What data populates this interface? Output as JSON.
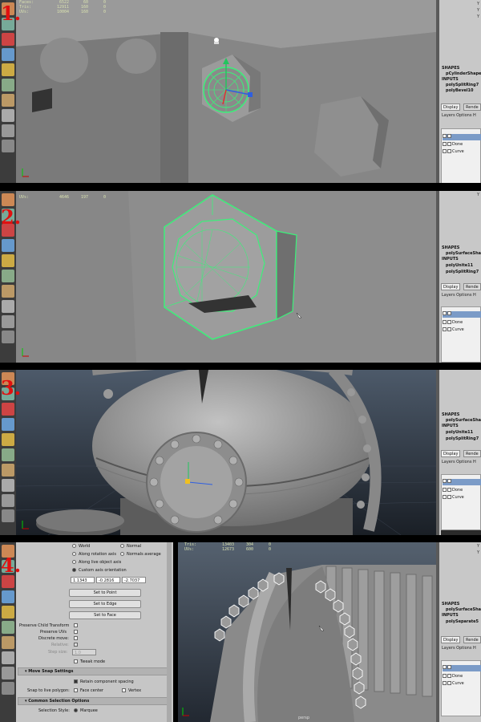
{
  "steps": [
    "1.",
    "2.",
    "3.",
    "4."
  ],
  "panel1": {
    "hud": [
      {
        "label": "Faces:",
        "v1": "6522",
        "v2": "60",
        "v3": "0"
      },
      {
        "label": "Tris:",
        "v1": "12911",
        "v2": "160",
        "v3": "0"
      },
      {
        "label": "UVs:",
        "v1": "10004",
        "v2": "160",
        "v3": "0"
      }
    ],
    "right": {
      "shapes_label": "SHAPES",
      "shape": "pCylinderShape",
      "inputs_label": "INPUTS",
      "inputs": [
        "polySplitRing7",
        "polyBevel10"
      ],
      "tabs": [
        "Display",
        "Rende"
      ],
      "menu": "Layers   Options   H",
      "layers": [
        "Done",
        "Curve"
      ]
    }
  },
  "panel2": {
    "hud": [
      {
        "label": "UVs:",
        "v1": "4646",
        "v2": "197",
        "v3": "0"
      }
    ],
    "right": {
      "shapes_label": "SHAPES",
      "shape": "polySurfaceShap",
      "inputs_label": "INPUTS",
      "inputs": [
        "polyUnite11",
        "polySplitRing7"
      ],
      "tabs": [
        "Display",
        "Rende"
      ],
      "menu": "Layers   Options   H",
      "layers": [
        "Done",
        "Curve"
      ]
    }
  },
  "panel3": {
    "right": {
      "shapes_label": "SHAPES",
      "shape": "polySurfaceShap",
      "inputs_label": "INPUTS",
      "inputs": [
        "polyUnite11",
        "polySplitRing7"
      ],
      "tabs": [
        "Display",
        "Rende"
      ],
      "menu": "Layers   Options   H",
      "layers": [
        "Done",
        "Curve"
      ]
    }
  },
  "panel4": {
    "hud": [
      {
        "label": "Tris:",
        "v1": "13403",
        "v2": "304",
        "v3": "0"
      },
      {
        "label": "UVs:",
        "v1": "12673",
        "v2": "600",
        "v3": "0"
      }
    ],
    "tool_settings": {
      "axis_options": [
        "World",
        "Normal",
        "Along rotation axis",
        "Normals average",
        "Along live object axis",
        "Custom axis orientation"
      ],
      "coords": [
        "1.1343",
        "-0.2816",
        "-2.7037"
      ],
      "buttons": [
        "Set to Point",
        "Set to Edge",
        "Set to Face"
      ],
      "preserve_child": "Preserve Child Transform",
      "preserve_uvs": "Preserve UVs",
      "discrete_move": "Discrete move:",
      "relative": "Relative:",
      "step_size": "Step size:",
      "step_value": "1.0",
      "tweak_mode": "Tweak mode",
      "move_snap_section": "Move Snap Settings",
      "retain_spacing": "Retain component spacing",
      "snap_live": "Snap to live polygon:",
      "face_center": "Face center",
      "vertex": "Vertex",
      "common_section": "Common Selection Options",
      "selection_style": "Selection Style:",
      "marquee": "Marquee"
    },
    "persp": "persp",
    "right": {
      "shapes_label": "SHAPES",
      "shape": "polySurfaceSha",
      "inputs_label": "INPUTS",
      "inputs": [
        "polySeparate5"
      ],
      "tabs": [
        "Display",
        "Rende"
      ],
      "menu": "Layers   Options   H",
      "layers": [
        "Done",
        "Curve"
      ]
    }
  },
  "colors": {
    "selection": "#3cf07a",
    "step_number": "#e01010"
  }
}
